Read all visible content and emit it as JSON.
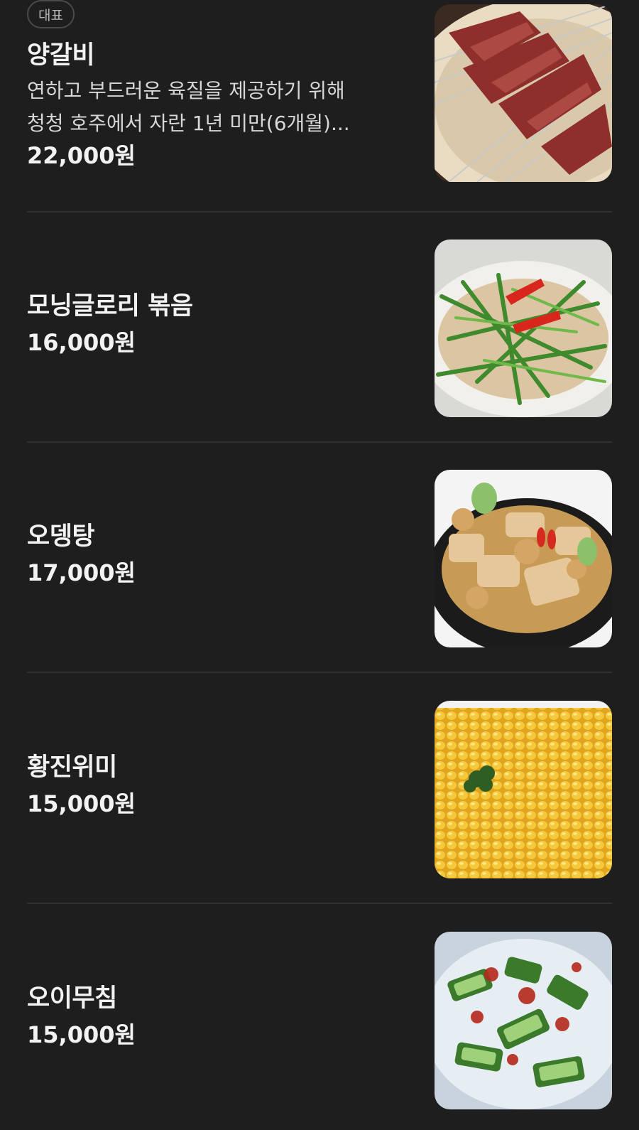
{
  "menu": {
    "items": [
      {
        "badge": "대표",
        "name": "양갈비",
        "desc_line1": "연하고 부드러운 육질을 제공하기 위해",
        "desc_line2": "청청 호주에서 자란 1년 미만(6개월)...",
        "price": "22,000원",
        "image": "grilled-lamb-skewers-photo"
      },
      {
        "name": "모닝글로리 볶음",
        "price": "16,000원",
        "image": "stir-fried-morning-glory-photo"
      },
      {
        "name": "오뎅탕",
        "price": "17,000원",
        "image": "fish-cake-soup-photo"
      },
      {
        "name": "황진위미",
        "price": "15,000원",
        "image": "corn-dish-photo"
      },
      {
        "name": "오이무침",
        "price": "15,000원",
        "image": "spicy-cucumber-salad-photo"
      }
    ]
  },
  "colors": {
    "background": "#1e1e1f",
    "text": "#f2f2f2",
    "divider": "#2f2f31"
  }
}
